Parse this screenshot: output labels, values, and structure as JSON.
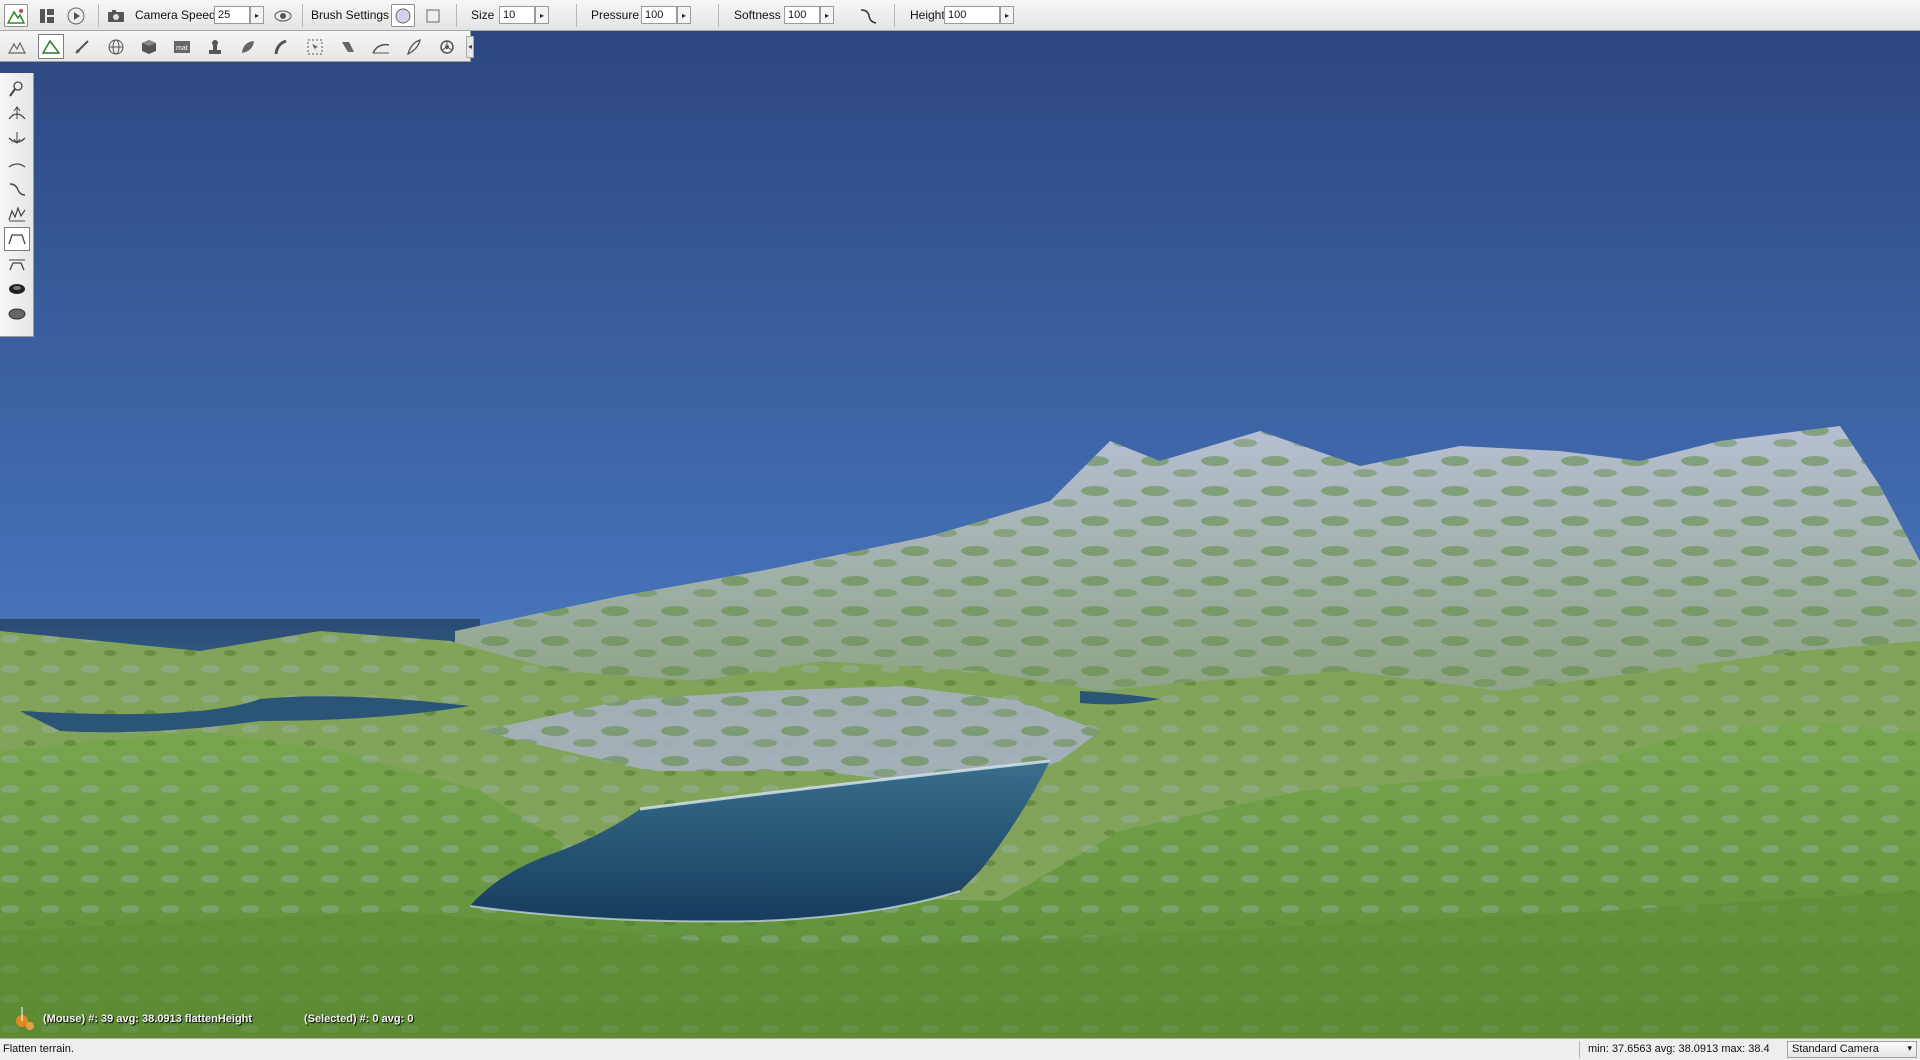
{
  "toolbar": {
    "camera_speed_label": "Camera Speed",
    "camera_speed_value": "25",
    "brush_settings_label": "Brush Settings",
    "size_label": "Size",
    "size_value": "10",
    "pressure_label": "Pressure",
    "pressure_value": "100",
    "softness_label": "Softness",
    "softness_value": "100",
    "height_label": "Height",
    "height_value": "100",
    "icons": [
      "terrain-editor-icon",
      "layout-icon",
      "play-icon",
      "camera-icon",
      "eye-icon",
      "circle-brush-icon",
      "square-brush-icon",
      "softness-curve-icon"
    ]
  },
  "toolrow": {
    "icons": [
      "terrain-paint-icon",
      "terrain-sculpt-icon",
      "brush-icon",
      "globe-icon",
      "cube-icon",
      "material-icon",
      "stamp-icon",
      "leaf-icon",
      "road-icon",
      "selection-icon",
      "river-icon",
      "erosion-icon",
      "feather-icon",
      "settings-wheel-icon"
    ],
    "collapse_glyph": "◂"
  },
  "sidetools": {
    "icons": [
      "raise-tool-icon",
      "lift-tool-icon",
      "lower-tool-icon",
      "smooth-tool-icon",
      "slope-tool-icon",
      "noise-tool-icon",
      "flatten-tool-icon",
      "plateau-tool-icon",
      "hole-tool-icon",
      "fill-tool-icon"
    ]
  },
  "viewport": {
    "mouse_info": "(Mouse) #: 39  avg: 38.0913 flattenHeight",
    "selected_info": "(Selected) #: 0  avg: 0",
    "colors": {
      "sky_top": "#2f4d86",
      "sky_bottom": "#5c8ad0",
      "grass": "#6f9a45",
      "rock": "#a9b3c9",
      "water": "#2f5b7d"
    }
  },
  "statusbar": {
    "message": "Flatten terrain.",
    "stats": "min: 37.6563  avg: 38.0913  max: 38.4",
    "camera": "Standard Camera"
  }
}
